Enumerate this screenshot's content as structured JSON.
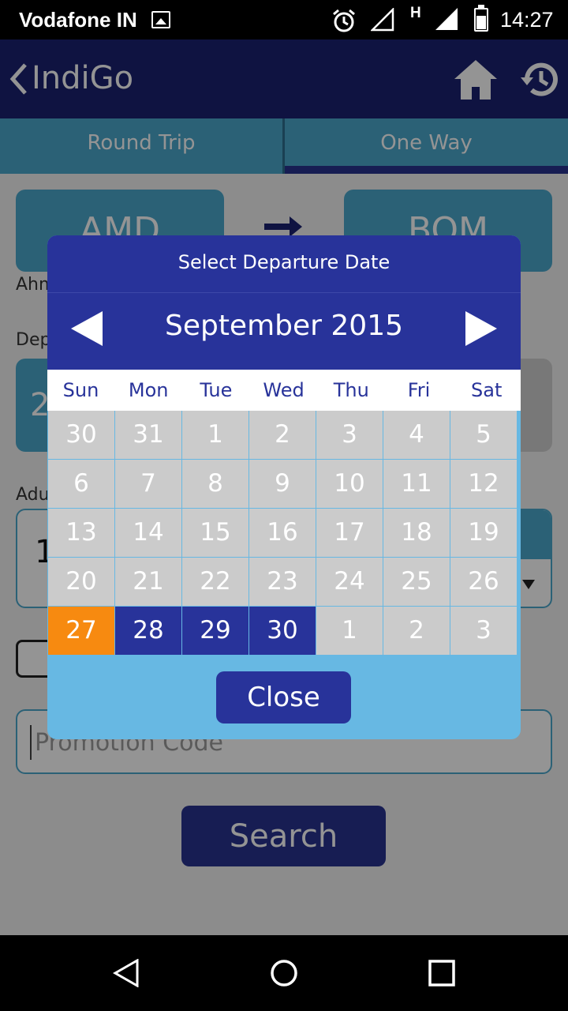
{
  "status_bar": {
    "carrier": "Vodafone IN",
    "network_type": "H",
    "time": "14:27",
    "icons": [
      "gallery-icon",
      "alarm-icon",
      "signal-empty-icon",
      "signal-full-icon",
      "battery-icon"
    ]
  },
  "app_bar": {
    "title": "IndiGo",
    "icons": [
      "back-chevron-icon",
      "home-icon",
      "history-icon"
    ]
  },
  "tabs": [
    {
      "label": "Round Trip",
      "active": false
    },
    {
      "label": "One Way",
      "active": true
    }
  ],
  "form": {
    "from_code": "AMD",
    "to_code": "BOM",
    "from_city_partial": "Ahm",
    "departure_label_partial": "Dep",
    "date_partial": "2",
    "adult_label_partial": "Adu",
    "adult_value_partial": "1",
    "promo_placeholder": "Promotion Code",
    "search_label": "Search"
  },
  "dialog": {
    "title": "Select Departure Date",
    "month": "September 2015",
    "weekdays": [
      "Sun",
      "Mon",
      "Tue",
      "Wed",
      "Thu",
      "Fri",
      "Sat"
    ],
    "weeks": [
      [
        {
          "d": "30",
          "s": "off"
        },
        {
          "d": "31",
          "s": "off"
        },
        {
          "d": "1",
          "s": "off"
        },
        {
          "d": "2",
          "s": "off"
        },
        {
          "d": "3",
          "s": "off"
        },
        {
          "d": "4",
          "s": "off"
        },
        {
          "d": "5",
          "s": "off"
        }
      ],
      [
        {
          "d": "6",
          "s": "off"
        },
        {
          "d": "7",
          "s": "off"
        },
        {
          "d": "8",
          "s": "off"
        },
        {
          "d": "9",
          "s": "off"
        },
        {
          "d": "10",
          "s": "off"
        },
        {
          "d": "11",
          "s": "off"
        },
        {
          "d": "12",
          "s": "off"
        }
      ],
      [
        {
          "d": "13",
          "s": "off"
        },
        {
          "d": "14",
          "s": "off"
        },
        {
          "d": "15",
          "s": "off"
        },
        {
          "d": "16",
          "s": "off"
        },
        {
          "d": "17",
          "s": "off"
        },
        {
          "d": "18",
          "s": "off"
        },
        {
          "d": "19",
          "s": "off"
        }
      ],
      [
        {
          "d": "20",
          "s": "off"
        },
        {
          "d": "21",
          "s": "off"
        },
        {
          "d": "22",
          "s": "off"
        },
        {
          "d": "23",
          "s": "off"
        },
        {
          "d": "24",
          "s": "off"
        },
        {
          "d": "25",
          "s": "off"
        },
        {
          "d": "26",
          "s": "off"
        }
      ],
      [
        {
          "d": "27",
          "s": "today"
        },
        {
          "d": "28",
          "s": "avail"
        },
        {
          "d": "29",
          "s": "avail"
        },
        {
          "d": "30",
          "s": "avail"
        },
        {
          "d": "1",
          "s": "off"
        },
        {
          "d": "2",
          "s": "off"
        },
        {
          "d": "3",
          "s": "off"
        }
      ]
    ],
    "close_label": "Close"
  },
  "colors": {
    "brand_navy": "#28339a",
    "sky_blue": "#67b8e3",
    "today_orange": "#f78a10",
    "disabled_gray": "#cbcbcb"
  },
  "nav_bar": {
    "icons": [
      "back-triangle-icon",
      "home-circle-icon",
      "recent-apps-icon"
    ]
  }
}
